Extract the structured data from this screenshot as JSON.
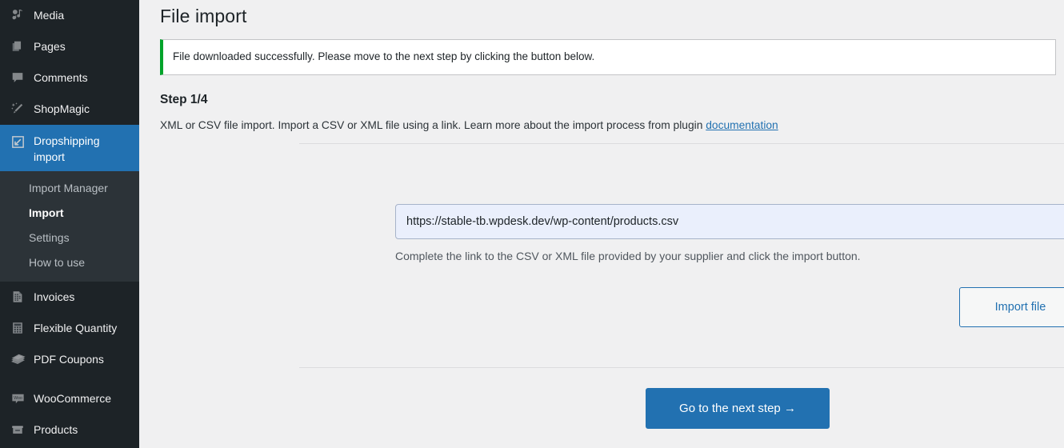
{
  "sidebar": {
    "items": [
      {
        "label": "Media",
        "icon": "media-icon",
        "active": false
      },
      {
        "label": "Pages",
        "icon": "pages-icon",
        "active": false
      },
      {
        "label": "Comments",
        "icon": "comments-icon",
        "active": false
      },
      {
        "label": "ShopMagic",
        "icon": "magic-wand-icon",
        "active": false
      },
      {
        "label": "Dropshipping import",
        "icon": "import-arrow-icon",
        "active": true
      },
      {
        "label": "Invoices",
        "icon": "invoice-document-icon",
        "active": false
      },
      {
        "label": "Flexible Quantity",
        "icon": "calculator-icon",
        "active": false
      },
      {
        "label": "PDF Coupons",
        "icon": "coupons-icon",
        "active": false
      },
      {
        "label": "WooCommerce",
        "icon": "woocommerce-icon",
        "active": false
      },
      {
        "label": "Products",
        "icon": "products-box-icon",
        "active": false
      }
    ],
    "submenu": [
      {
        "label": "Import Manager",
        "current": false
      },
      {
        "label": "Import",
        "current": true
      },
      {
        "label": "Settings",
        "current": false
      },
      {
        "label": "How to use",
        "current": false
      }
    ]
  },
  "main": {
    "page_title": "File import",
    "notice": {
      "text": "File downloaded successfully. Please move to the next step by clicking the button below.",
      "accent_color": "#00a32a"
    },
    "step_heading": "Step 1/4",
    "step_description_before": "XML or CSV file import. Import a CSV or XML file using a link. Learn more about the import process from plugin ",
    "step_description_link": "documentation",
    "url_field": {
      "value": "https://stable-tb.wpdesk.dev/wp-content/products.csv",
      "placeholder": "https://",
      "help": "Complete the link to the CSV or XML file provided by your supplier and click the import button."
    },
    "import_button": "Import file",
    "next_step_button": "Go to the next step  →"
  },
  "colors": {
    "sidebar_bg": "#1d2327",
    "submenu_bg": "#2c3338",
    "accent_blue": "#2271b1",
    "content_bg": "#f0f0f1",
    "success_green": "#00a32a",
    "input_bg": "#eaeffc"
  }
}
